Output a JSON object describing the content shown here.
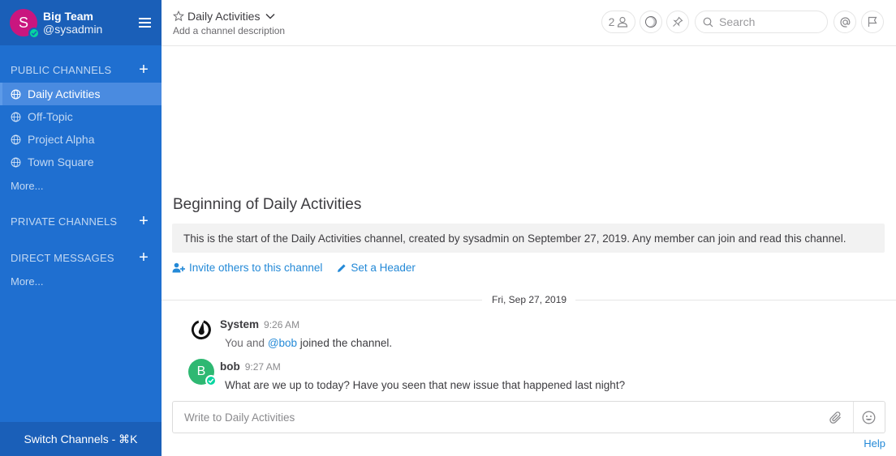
{
  "team": {
    "avatar_letter": "S",
    "name": "Big Team",
    "username": "@sysadmin"
  },
  "sidebar": {
    "public_channels_label": "PUBLIC CHANNELS",
    "public_channels": [
      "Daily Activities",
      "Off-Topic",
      "Project Alpha",
      "Town Square"
    ],
    "public_more": "More...",
    "private_channels_label": "PRIVATE CHANNELS",
    "direct_messages_label": "DIRECT MESSAGES",
    "dm_more": "More...",
    "switch_channels": "Switch Channels - ⌘K"
  },
  "header": {
    "channel_name": "Daily Activities",
    "description": "Add a channel description",
    "member_count": "2",
    "search_placeholder": "Search"
  },
  "intro": {
    "title": "Beginning of Daily Activities",
    "text": "This is the start of the Daily Activities channel, created by sysadmin on September 27, 2019. Any member can join and read this channel.",
    "invite_label": "Invite others to this channel",
    "header_label": "Set a Header"
  },
  "date_separator": "Fri, Sep 27, 2019",
  "posts": [
    {
      "author": "System",
      "time": "9:26 AM",
      "body_prefix": "You and ",
      "mention": "@bob",
      "body_suffix": " joined the channel."
    },
    {
      "author": "bob",
      "avatar_letter": "B",
      "time": "9:27 AM",
      "body": "What are we up to today?  Have you seen that new issue that happened last night?"
    }
  ],
  "composer": {
    "placeholder": "Write to Daily Activities"
  },
  "help_label": "Help",
  "colors": {
    "sidebar": "#1f6fd0",
    "sidebar_header": "#1a5fb8",
    "active_channel": "#4a8be0",
    "link": "#2389d7",
    "online": "#06d6a0",
    "bob_avatar": "#2eb872"
  }
}
